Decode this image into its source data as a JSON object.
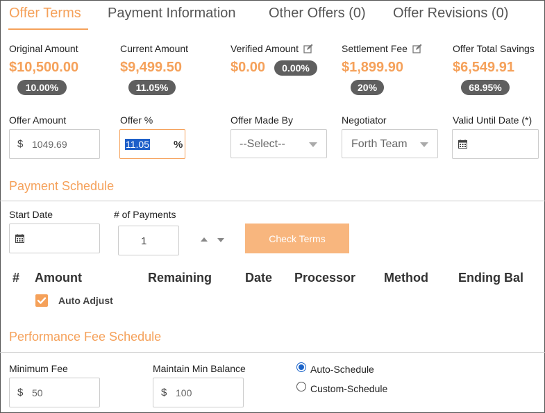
{
  "tabs": [
    {
      "label": "Offer Terms",
      "active": true
    },
    {
      "label": "Payment Information",
      "active": false
    },
    {
      "label": "Other Offers (0)",
      "active": false
    },
    {
      "label": "Offer Revisions (0)",
      "active": false
    }
  ],
  "stats": {
    "original": {
      "label": "Original Amount",
      "value": "$10,500.00",
      "badge": "10.00%"
    },
    "current": {
      "label": "Current Amount",
      "value": "$9,499.50",
      "badge": "11.05%"
    },
    "verified": {
      "label": "Verified Amount",
      "value": "$0.00",
      "badge": "0.00%",
      "icon": "edit-icon"
    },
    "settlement": {
      "label": "Settlement Fee",
      "value": "$1,899.90",
      "badge": "20%",
      "icon": "edit-icon"
    },
    "savings": {
      "label": "Offer Total Savings",
      "value": "$6,549.91",
      "badge": "68.95%"
    }
  },
  "offer": {
    "amount": {
      "label": "Offer Amount",
      "prefix": "$",
      "placeholder": "1049.69"
    },
    "percent": {
      "label": "Offer %",
      "value": "11.05",
      "suffix": "%"
    },
    "made_by": {
      "label": "Offer Made By",
      "selected": "--Select--"
    },
    "negotiator": {
      "label": "Negotiator",
      "selected": "Forth Team"
    },
    "valid_until": {
      "label": "Valid Until Date (*)",
      "icon": "calendar-icon"
    }
  },
  "payment_schedule": {
    "title": "Payment Schedule",
    "start_date": {
      "label": "Start Date",
      "icon": "calendar-icon"
    },
    "num_payments": {
      "label": "# of Payments",
      "value": "1"
    },
    "check_terms": "Check Terms",
    "columns": [
      "#",
      "Amount",
      "Remaining",
      "Date",
      "Processor",
      "Method",
      "Ending Bal"
    ],
    "auto_adjust": {
      "label": "Auto Adjust",
      "checked": true
    }
  },
  "performance_fee": {
    "title": "Performance Fee Schedule",
    "minimum_fee": {
      "label": "Minimum Fee",
      "prefix": "$",
      "placeholder": "50"
    },
    "maintain_min": {
      "label": "Maintain Min Balance",
      "prefix": "$",
      "placeholder": "100"
    },
    "options": [
      {
        "label": "Auto-Schedule",
        "selected": true
      },
      {
        "label": "Custom-Schedule",
        "selected": false
      }
    ]
  },
  "colors": {
    "accent": "#f5a15a",
    "badge": "#5f5f5f",
    "button": "#f8b67e",
    "radio": "#1a63c9"
  }
}
